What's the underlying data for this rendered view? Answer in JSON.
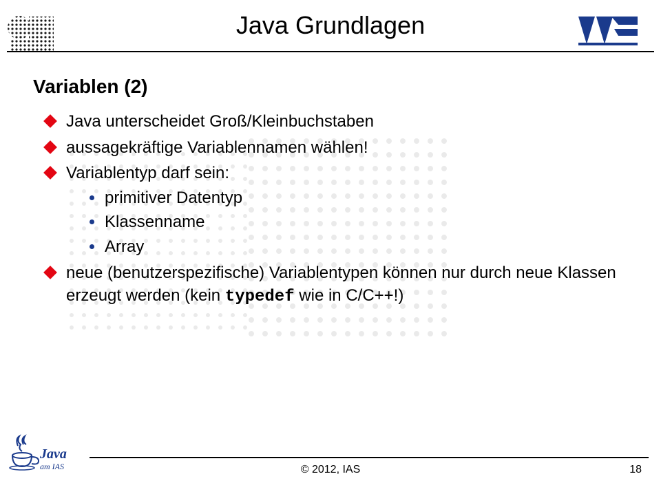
{
  "header": {
    "title": "Java Grundlagen"
  },
  "section": {
    "heading": "Variablen (2)"
  },
  "bullets": {
    "b1": "Java unterscheidet Groß/Kleinbuchstaben",
    "b2": "aussagekräftige Variablennamen wählen!",
    "b3": "Variablentyp darf sein:",
    "b3_sub": {
      "s1": "primitiver Datentyp",
      "s2": "Klassenname",
      "s3": "Array"
    },
    "b4_pre": "neue (benutzerspezifische) Variablentypen können nur durch neue Klassen erzeugt werden (kein ",
    "b4_code": "typedef",
    "b4_post": " wie in C/C++!)"
  },
  "footer": {
    "copyright": "© 2012, IAS",
    "page": "18"
  },
  "java_logo": {
    "main": "Java",
    "sub": "am IAS"
  }
}
